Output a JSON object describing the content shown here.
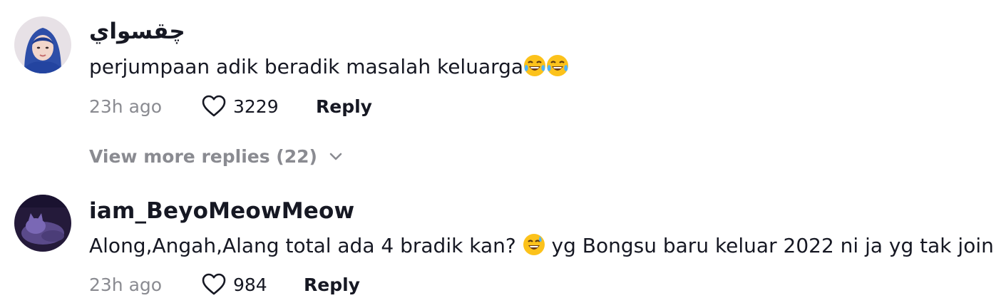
{
  "comments": [
    {
      "username": "چقسواي",
      "text": "perjumpaan adik beradik masalah keluarga",
      "emojis": [
        "tears-of-joy",
        "tears-of-joy"
      ],
      "time": "23h ago",
      "likes": "3229",
      "reply_label": "Reply"
    },
    {
      "username": "iam_BeyoMeowMeow",
      "text_before_emoji": "Along,Angah,Alang total ada 4 bradik kan?",
      "emoji": "grinning-sweat",
      "text_after_emoji": "yg Bongsu baru keluar 2022 ni ja yg tak join",
      "time": "23h ago",
      "likes": "984",
      "reply_label": "Reply"
    }
  ],
  "more_replies_label": "View more replies (22)",
  "colors": {
    "text_primary": "#161823",
    "text_secondary": "#8a8b91",
    "emoji_yellow": "#fcc21b"
  }
}
